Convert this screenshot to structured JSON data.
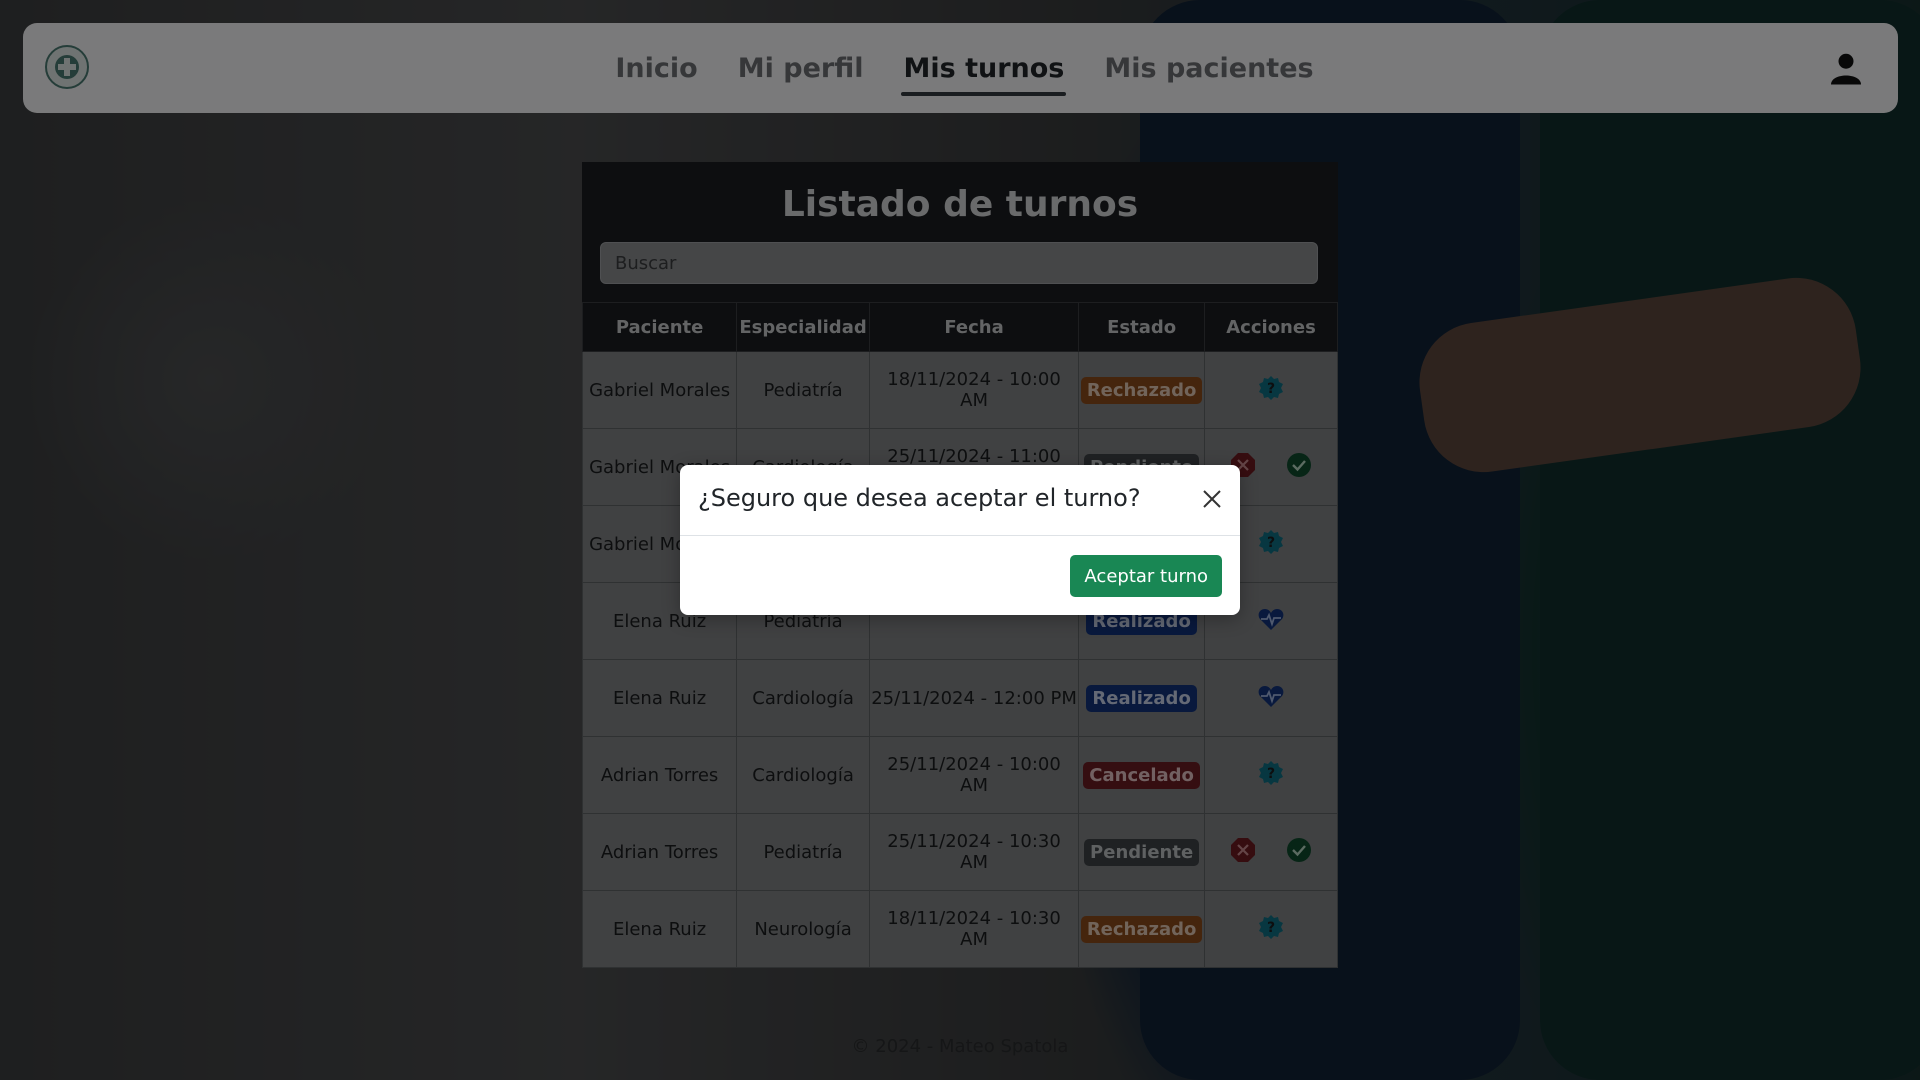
{
  "navbar": {
    "links": [
      "Inicio",
      "Mi perfil",
      "Mis turnos",
      "Mis pacientes"
    ],
    "active": "Mis turnos"
  },
  "panel": {
    "title": "Listado de turnos",
    "search_placeholder": "Buscar",
    "columns": [
      "Paciente",
      "Especialidad",
      "Fecha",
      "Estado",
      "Acciones"
    ],
    "rows": [
      {
        "paciente": "Gabriel Morales",
        "especialidad": "Pediatría",
        "fecha": "18/11/2024 - 10:00 AM",
        "estado": "Rechazado",
        "acciones": [
          "review"
        ]
      },
      {
        "paciente": "Gabriel Morales",
        "especialidad": "Cardiología",
        "fecha": "25/11/2024 - 11:00 AM",
        "estado": "Pendiente",
        "acciones": [
          "reject",
          "accept"
        ]
      },
      {
        "paciente": "Gabriel Morales",
        "especialidad": "",
        "fecha": "",
        "estado": "",
        "acciones": [
          "review"
        ]
      },
      {
        "paciente": "Elena Ruiz",
        "especialidad": "Pediatría",
        "fecha": "",
        "estado": "Realizado",
        "acciones": [
          "history"
        ]
      },
      {
        "paciente": "Elena Ruiz",
        "especialidad": "Cardiología",
        "fecha": "25/11/2024 - 12:00 PM",
        "estado": "Realizado",
        "acciones": [
          "history"
        ]
      },
      {
        "paciente": "Adrian Torres",
        "especialidad": "Cardiología",
        "fecha": "25/11/2024 - 10:00 AM",
        "estado": "Cancelado",
        "acciones": [
          "review"
        ]
      },
      {
        "paciente": "Adrian Torres",
        "especialidad": "Pediatría",
        "fecha": "25/11/2024 - 10:30 AM",
        "estado": "Pendiente",
        "acciones": [
          "reject",
          "accept"
        ]
      },
      {
        "paciente": "Elena Ruiz",
        "especialidad": "Neurología",
        "fecha": "18/11/2024 - 10:30 AM",
        "estado": "Rechazado",
        "acciones": [
          "review"
        ]
      }
    ]
  },
  "modal": {
    "title": "¿Seguro que desea aceptar el turno?",
    "confirm_label": "Aceptar turno"
  },
  "footer": {
    "text": "© 2024 - Mateo Spatola"
  },
  "colors": {
    "accept": "#198754",
    "reject": "#dc3545",
    "info": "#0dcaf0",
    "primary": "#0d6efd"
  }
}
